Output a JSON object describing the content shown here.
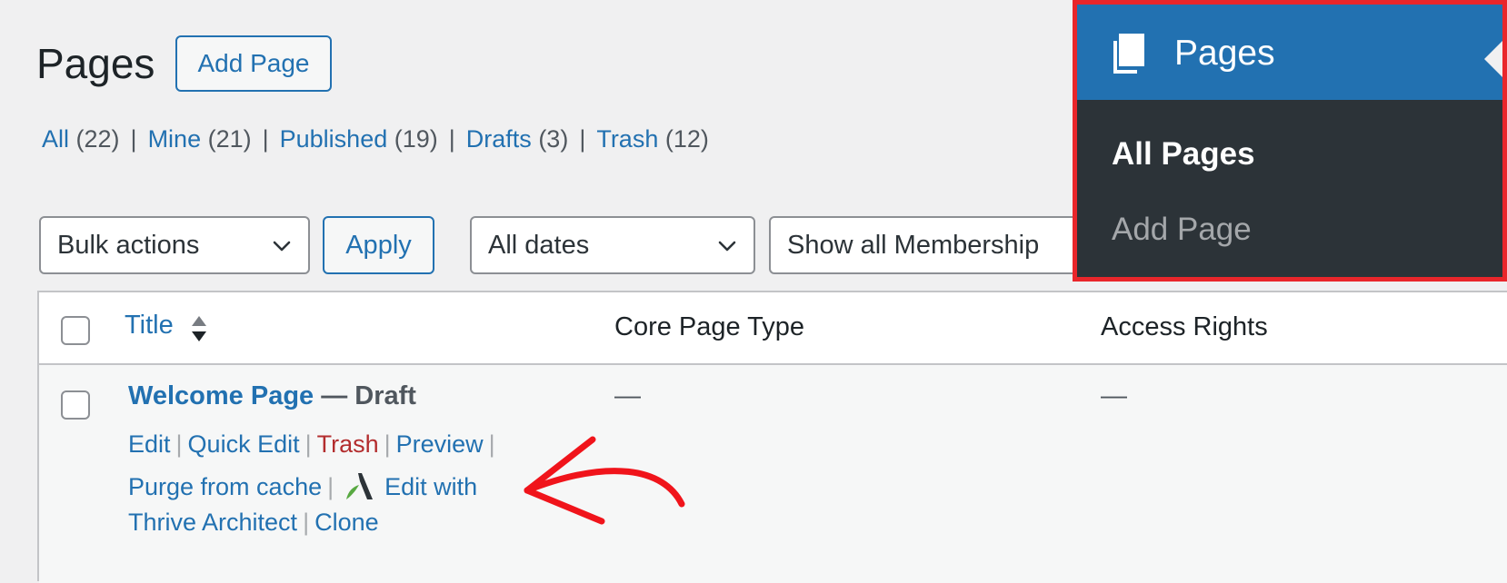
{
  "page": {
    "title": "Pages",
    "add_button": "Add Page"
  },
  "filters": [
    {
      "label": "All",
      "count": "(22)"
    },
    {
      "label": "Mine",
      "count": "(21)"
    },
    {
      "label": "Published",
      "count": "(19)"
    },
    {
      "label": "Drafts",
      "count": "(3)"
    },
    {
      "label": "Trash",
      "count": "(12)"
    }
  ],
  "toolbar": {
    "bulk_actions": "Bulk actions",
    "apply": "Apply",
    "dates": "All dates",
    "membership": "Show all Membership"
  },
  "table": {
    "columns": {
      "title": "Title",
      "core_page_type": "Core Page Type",
      "access_rights": "Access Rights"
    },
    "rows": [
      {
        "title": "Welcome Page",
        "state": " — Draft",
        "core_page_type": "—",
        "access_rights": "—",
        "actions": {
          "edit": "Edit",
          "quick_edit": "Quick Edit",
          "trash": "Trash",
          "preview": "Preview",
          "purge": "Purge from cache",
          "edit_with": "Edit with",
          "thrive": "Thrive Architect",
          "clone": "Clone"
        }
      }
    ]
  },
  "admin_menu": {
    "section": "Pages",
    "items": [
      {
        "label": "All Pages",
        "current": true
      },
      {
        "label": "Add Page",
        "current": false
      }
    ]
  },
  "colors": {
    "accent": "#2271b1",
    "highlight_border": "#e9262b",
    "menu_bg": "#2c3338",
    "trash": "#b32d2e"
  },
  "icons": {
    "menu": "pages-icon",
    "sort": "sort-icon",
    "chevron": "chevron-down-icon",
    "builder": "thrive-architect-icon",
    "annotation": "red-arrow-annotation"
  }
}
